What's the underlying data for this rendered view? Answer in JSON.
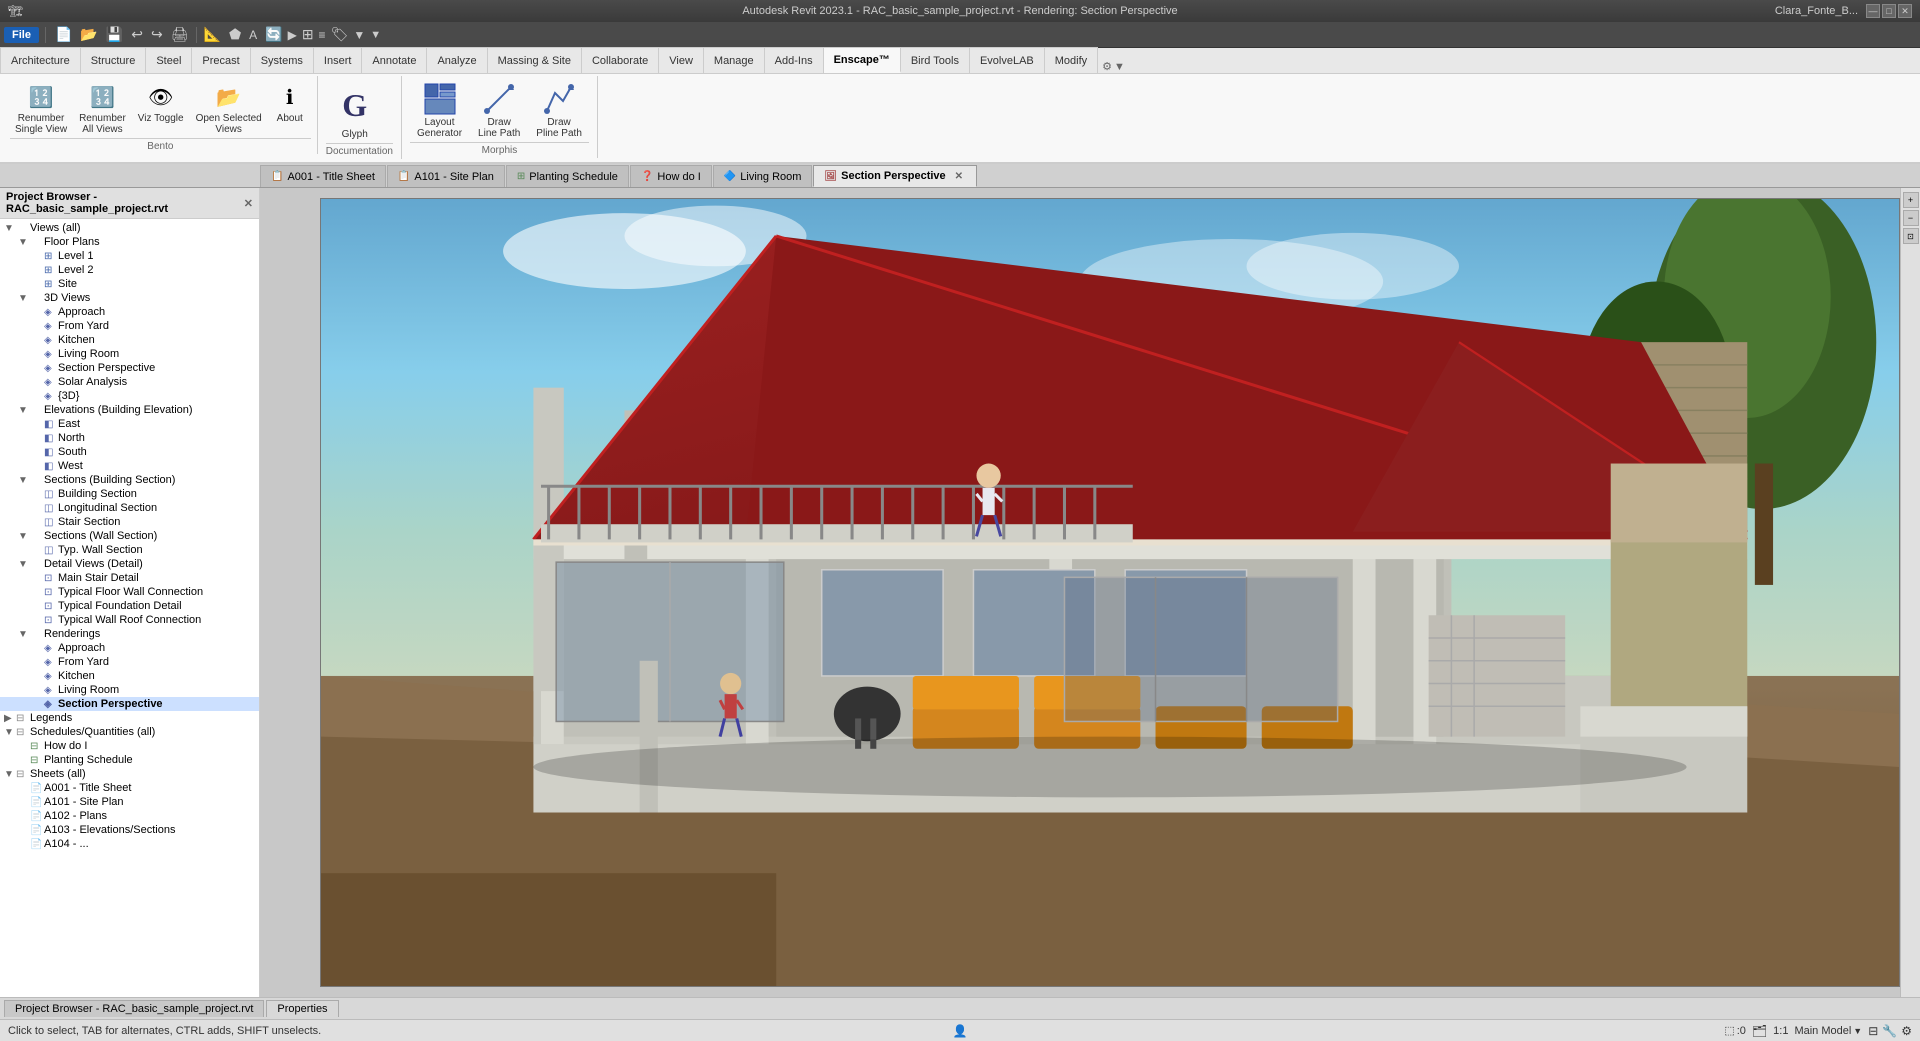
{
  "titlebar": {
    "title": "Autodesk Revit 2023.1 - RAC_basic_sample_project.rvt - Rendering: Section Perspective",
    "user": "Clara_Fonte_B...",
    "minimize": "—",
    "maximize": "□",
    "close": "✕"
  },
  "quick_access": {
    "buttons": [
      "📁",
      "💾",
      "↩",
      "↪",
      "🖨"
    ]
  },
  "ribbon": {
    "active_tab": "Enscape™",
    "tabs": [
      "File",
      "Architecture",
      "Structure",
      "Steel",
      "Precast",
      "Systems",
      "Insert",
      "Annotate",
      "Analyze",
      "Massing & Site",
      "Collaborate",
      "View",
      "Manage",
      "Add-Ins",
      "Enscape™",
      "Bird Tools",
      "EvolveLAB",
      "Modify"
    ],
    "groups": [
      {
        "label": "Bento",
        "items": [
          {
            "label": "Renumber\nSingle View",
            "icon": "🔢"
          },
          {
            "label": "Renumber\nAll Views",
            "icon": "🔢"
          },
          {
            "label": "Viz Toggle",
            "icon": "👁"
          },
          {
            "label": "Open Selected\nViews",
            "icon": "📂"
          },
          {
            "label": "About",
            "icon": "ℹ"
          }
        ]
      },
      {
        "label": "Documentation",
        "items": [
          {
            "label": "Glyph",
            "icon": "G"
          }
        ]
      },
      {
        "label": "Morphis",
        "items": [
          {
            "label": "Layout\nGenerator",
            "icon": "⊞"
          },
          {
            "label": "Draw\nLine Path",
            "icon": "✏"
          },
          {
            "label": "Draw\nPline Path",
            "icon": "✏"
          }
        ]
      }
    ]
  },
  "project_browser": {
    "title": "Project Browser - RAC_basic_sample_project.rvt",
    "tree": [
      {
        "level": 0,
        "type": "root",
        "label": "Views (all)",
        "expanded": true,
        "toggle": "▼"
      },
      {
        "level": 1,
        "type": "group",
        "label": "Floor Plans",
        "expanded": true,
        "toggle": "▼"
      },
      {
        "level": 2,
        "type": "item",
        "label": "Level 1",
        "icon": "⊞"
      },
      {
        "level": 2,
        "type": "item",
        "label": "Level 2",
        "icon": "⊞"
      },
      {
        "level": 2,
        "type": "item",
        "label": "Site",
        "icon": "⊞"
      },
      {
        "level": 1,
        "type": "group",
        "label": "3D Views",
        "expanded": true,
        "toggle": "▼"
      },
      {
        "level": 2,
        "type": "item",
        "label": "Approach",
        "icon": "◈"
      },
      {
        "level": 2,
        "type": "item",
        "label": "From Yard",
        "icon": "◈"
      },
      {
        "level": 2,
        "type": "item",
        "label": "Kitchen",
        "icon": "◈"
      },
      {
        "level": 2,
        "type": "item",
        "label": "Living Room",
        "icon": "◈"
      },
      {
        "level": 2,
        "type": "item",
        "label": "Section Perspective",
        "icon": "◈"
      },
      {
        "level": 2,
        "type": "item",
        "label": "Solar Analysis",
        "icon": "◈"
      },
      {
        "level": 2,
        "type": "item",
        "label": "{3D}",
        "icon": "◈"
      },
      {
        "level": 1,
        "type": "group",
        "label": "Elevations (Building Elevation)",
        "expanded": true,
        "toggle": "▼"
      },
      {
        "level": 2,
        "type": "item",
        "label": "East",
        "icon": "◧"
      },
      {
        "level": 2,
        "type": "item",
        "label": "North",
        "icon": "◧"
      },
      {
        "level": 2,
        "type": "item",
        "label": "South",
        "icon": "◧"
      },
      {
        "level": 2,
        "type": "item",
        "label": "West",
        "icon": "◧"
      },
      {
        "level": 1,
        "type": "group",
        "label": "Sections (Building Section)",
        "expanded": true,
        "toggle": "▼"
      },
      {
        "level": 2,
        "type": "item",
        "label": "Building Section",
        "icon": "◫"
      },
      {
        "level": 2,
        "type": "item",
        "label": "Longitudinal Section",
        "icon": "◫"
      },
      {
        "level": 2,
        "type": "item",
        "label": "Stair Section",
        "icon": "◫"
      },
      {
        "level": 1,
        "type": "group",
        "label": "Sections (Wall Section)",
        "expanded": true,
        "toggle": "▼"
      },
      {
        "level": 2,
        "type": "item",
        "label": "Typ. Wall Section",
        "icon": "◫"
      },
      {
        "level": 1,
        "type": "group",
        "label": "Detail Views (Detail)",
        "expanded": true,
        "toggle": "▼"
      },
      {
        "level": 2,
        "type": "item",
        "label": "Main Stair Detail",
        "icon": "⊡"
      },
      {
        "level": 2,
        "type": "item",
        "label": "Typical Floor Wall Connection",
        "icon": "⊡"
      },
      {
        "level": 2,
        "type": "item",
        "label": "Typical Foundation Detail",
        "icon": "⊡"
      },
      {
        "level": 2,
        "type": "item",
        "label": "Typical Wall Roof Connection",
        "icon": "⊡"
      },
      {
        "level": 1,
        "type": "group",
        "label": "Renderings",
        "expanded": true,
        "toggle": "▼"
      },
      {
        "level": 2,
        "type": "item",
        "label": "Approach",
        "icon": "◈"
      },
      {
        "level": 2,
        "type": "item",
        "label": "From Yard",
        "icon": "◈"
      },
      {
        "level": 2,
        "type": "item",
        "label": "Kitchen",
        "icon": "◈"
      },
      {
        "level": 2,
        "type": "item",
        "label": "Living Room",
        "icon": "◈"
      },
      {
        "level": 2,
        "type": "item",
        "label": "Section Perspective",
        "icon": "◈",
        "selected": true
      },
      {
        "level": 0,
        "type": "group",
        "label": "Legends",
        "expanded": false,
        "toggle": "▶"
      },
      {
        "level": 0,
        "type": "group",
        "label": "Schedules/Quantities (all)",
        "expanded": true,
        "toggle": "▼"
      },
      {
        "level": 1,
        "type": "item",
        "label": "How do I",
        "icon": "⊟"
      },
      {
        "level": 1,
        "type": "item",
        "label": "Planting Schedule",
        "icon": "⊟"
      },
      {
        "level": 0,
        "type": "group",
        "label": "Sheets (all)",
        "expanded": true,
        "toggle": "▼"
      },
      {
        "level": 1,
        "type": "item",
        "label": "A001 - Title Sheet",
        "icon": "📄"
      },
      {
        "level": 1,
        "type": "item",
        "label": "A101 - Site Plan",
        "icon": "📄"
      },
      {
        "level": 1,
        "type": "item",
        "label": "A102 - Plans",
        "icon": "📄"
      },
      {
        "level": 1,
        "type": "item",
        "label": "A103 - Elevations/Sections",
        "icon": "📄"
      },
      {
        "level": 1,
        "type": "item",
        "label": "A104 - ...",
        "icon": "📄"
      }
    ]
  },
  "view_tabs": [
    {
      "label": "A001 - Title Sheet",
      "icon": "📋",
      "active": false,
      "closeable": false
    },
    {
      "label": "A101 - Site Plan",
      "icon": "📋",
      "active": false,
      "closeable": false
    },
    {
      "label": "Planting Schedule",
      "icon": "📊",
      "active": false,
      "closeable": false
    },
    {
      "label": "How do I",
      "icon": "❓",
      "active": false,
      "closeable": false
    },
    {
      "label": "Living Room",
      "icon": "🔷",
      "active": false,
      "closeable": false
    },
    {
      "label": "Section Perspective",
      "icon": "🖼",
      "active": true,
      "closeable": true
    }
  ],
  "canvas": {
    "view_title": "Section Perspective",
    "scale": "1:1",
    "workset": "Main Model"
  },
  "statusbar": {
    "left": "Click to select, TAB for alternates, CTRL adds, SHIFT unselects.",
    "scale": "1:1",
    "workset": "Main Model"
  },
  "bottom_tabs": [
    {
      "label": "Project Browser - RAC_basic_sample_project.rvt"
    },
    {
      "label": "Properties"
    }
  ],
  "colors": {
    "accent_blue": "#2060c0",
    "selected_item_bg": "#1060c0",
    "ribbon_bg": "#f8f8f8",
    "tab_active_bg": "#ffffff"
  }
}
